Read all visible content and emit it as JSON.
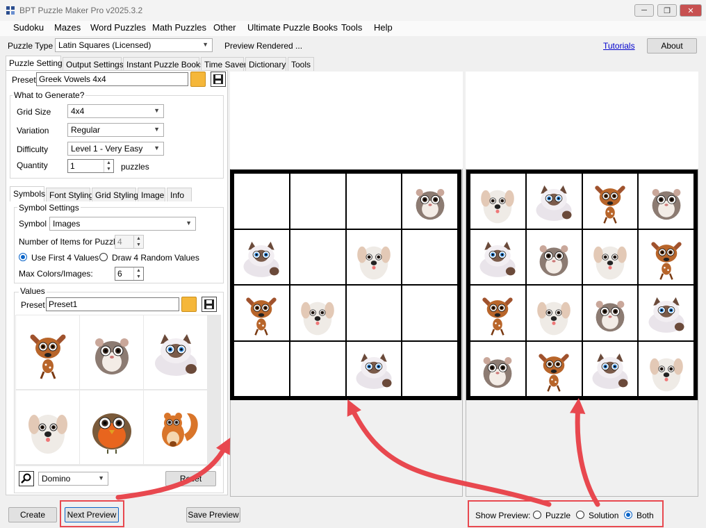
{
  "window": {
    "title": "BPT Puzzle Maker Pro v2025.3.2"
  },
  "menu": [
    "Sudoku",
    "Mazes",
    "Word Puzzles",
    "Math Puzzles",
    "Other",
    "Ultimate Puzzle Books",
    "Tools",
    "Help"
  ],
  "toolbar": {
    "puzzle_type_label": "Puzzle Type",
    "puzzle_type_value": "Latin Squares (Licensed)",
    "status": "Preview Rendered ...",
    "tutorials": "Tutorials",
    "about": "About"
  },
  "main_tabs": [
    "Puzzle Settings",
    "Output Settings",
    "Instant Puzzle Books",
    "Time Saver",
    "Dictionary",
    "Tools"
  ],
  "preset": {
    "label": "Preset",
    "value": "Greek Vowels 4x4"
  },
  "generate": {
    "title": "What to Generate?",
    "grid_size_label": "Grid Size",
    "grid_size_value": "4x4",
    "variation_label": "Variation",
    "variation_value": "Regular",
    "difficulty_label": "Difficulty",
    "difficulty_value": "Level 1 - Very Easy",
    "quantity_label": "Quantity",
    "quantity_value": "1",
    "quantity_unit": "puzzles"
  },
  "sub_tabs": [
    "Symbols",
    "Font Styling",
    "Grid Styling",
    "Image",
    "Info"
  ],
  "symbol_settings": {
    "title": "Symbol Settings",
    "symbol_label": "Symbol",
    "symbol_value": "Images",
    "items_label": "Number of Items for Puzzle:",
    "items_value": "4",
    "use_first": "Use First 4 Values",
    "draw_random": "Draw 4 Random Values",
    "max_colors_label": "Max Colors/Images:",
    "max_colors_value": "6"
  },
  "values": {
    "title": "Values",
    "preset_label": "Preset",
    "preset_value": "Preset1",
    "images": [
      "fawn",
      "hamster",
      "cat",
      "dog",
      "robin",
      "squirrel"
    ],
    "style_value": "Domino",
    "reset": "Reset"
  },
  "puzzle_grid": [
    [
      "",
      "",
      "",
      "hamster"
    ],
    [
      "cat",
      "",
      "dog",
      ""
    ],
    [
      "fawn",
      "dog",
      "",
      ""
    ],
    [
      "",
      "",
      "cat",
      ""
    ]
  ],
  "solution_grid": [
    [
      "dog",
      "cat",
      "fawn",
      "hamster"
    ],
    [
      "cat",
      "hamster",
      "dog",
      "fawn"
    ],
    [
      "fawn",
      "dog",
      "hamster",
      "cat"
    ],
    [
      "hamster",
      "fawn",
      "cat",
      "dog"
    ]
  ],
  "bottom": {
    "create": "Create",
    "next_preview": "Next Preview",
    "save_preview": "Save Preview",
    "show_preview_label": "Show Preview:",
    "opt_puzzle": "Puzzle",
    "opt_solution": "Solution",
    "opt_both": "Both",
    "selected": "Both"
  },
  "colors": {
    "annotation_red": "#e8484f",
    "link_blue": "#0000cc",
    "radio_blue": "#0a64c8"
  }
}
